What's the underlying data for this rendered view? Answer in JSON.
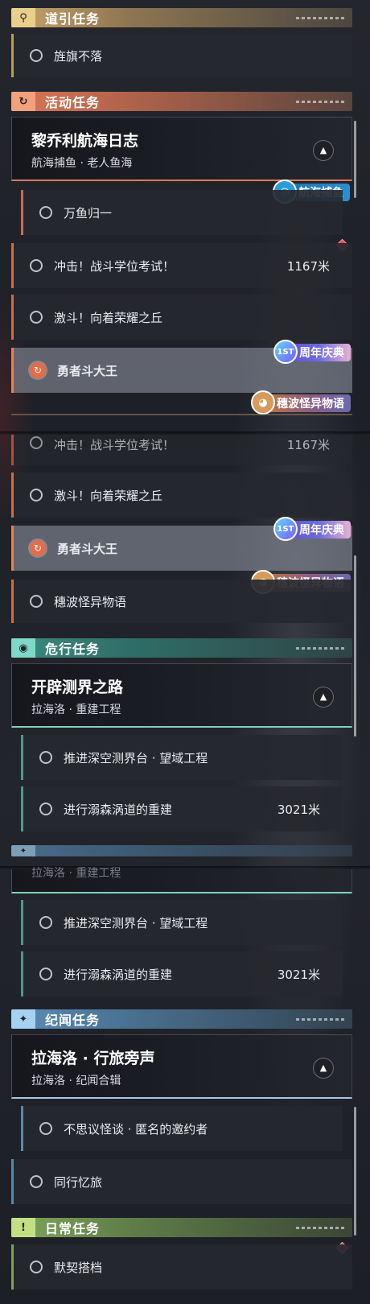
{
  "sections": {
    "guide": {
      "title": "道引任务",
      "icon": "map-pin-icon"
    },
    "activity": {
      "title": "活动任务",
      "icon": "refresh-quest-icon"
    },
    "danger": {
      "title": "危行任务",
      "icon": "eye-badge-icon"
    },
    "lore": {
      "title": "纪闻任务",
      "icon": "sparkle-star-icon"
    },
    "daily": {
      "title": "日常任务",
      "icon": "exclamation-icon"
    }
  },
  "frame1": {
    "guide_quest": "旌旗不落",
    "card": {
      "title": "黎乔利航海日志",
      "subtitle": "航海捕鱼 · 老人鱼海"
    },
    "sub_quest": "万鱼归一",
    "badge_fish": "航海捕鱼",
    "quest_impact": "冲击！战斗学位考试！",
    "quest_impact_dist": "1167米",
    "quest_fight": "激斗！向着荣耀之丘",
    "quest_king": "勇者斗大王",
    "badge_anniv": "周年庆典",
    "badge_anniv_icon": "1ST",
    "badge_spooky": "穗波怪异物语"
  },
  "frame2": {
    "quest_impact": "冲击！战斗学位考试！",
    "quest_impact_dist": "1167米",
    "quest_fight": "激斗！向着荣耀之丘",
    "quest_king": "勇者斗大王",
    "badge_anniv": "周年庆典",
    "badge_anniv_icon": "1ST",
    "badge_spooky": "穗波怪异物语",
    "quest_spooky": "穗波怪异物语",
    "card": {
      "title": "开辟测界之路",
      "subtitle": "拉海洛 · 重建工程"
    },
    "sub_quest1": "推进深空测界台 · 望域工程",
    "sub_quest2": "进行溺森涡道的重建",
    "sub_quest2_dist": "3021米"
  },
  "frame3": {
    "card_subtitle_partial": "拉海洛 · 重建工程",
    "sub_quest1": "推进深空测界台 · 望域工程",
    "sub_quest2": "进行溺森涡道的重建",
    "sub_quest2_dist": "3021米",
    "card": {
      "title": "拉海洛 · 行旅旁声",
      "subtitle": "拉海洛 · 纪闻合辑"
    },
    "sub_quest3": "不思议怪谈 · 匿名的邀约者",
    "quest_companion": "同行忆旅",
    "quest_daily": "默契搭档"
  },
  "colors": {
    "guide": "#c7a36a",
    "activity": "#d87755",
    "danger": "#3c8c80",
    "lore": "#5a8cb8",
    "daily": "#7ea65a",
    "tracked": "#e66b47",
    "diamond": "#e04860"
  }
}
